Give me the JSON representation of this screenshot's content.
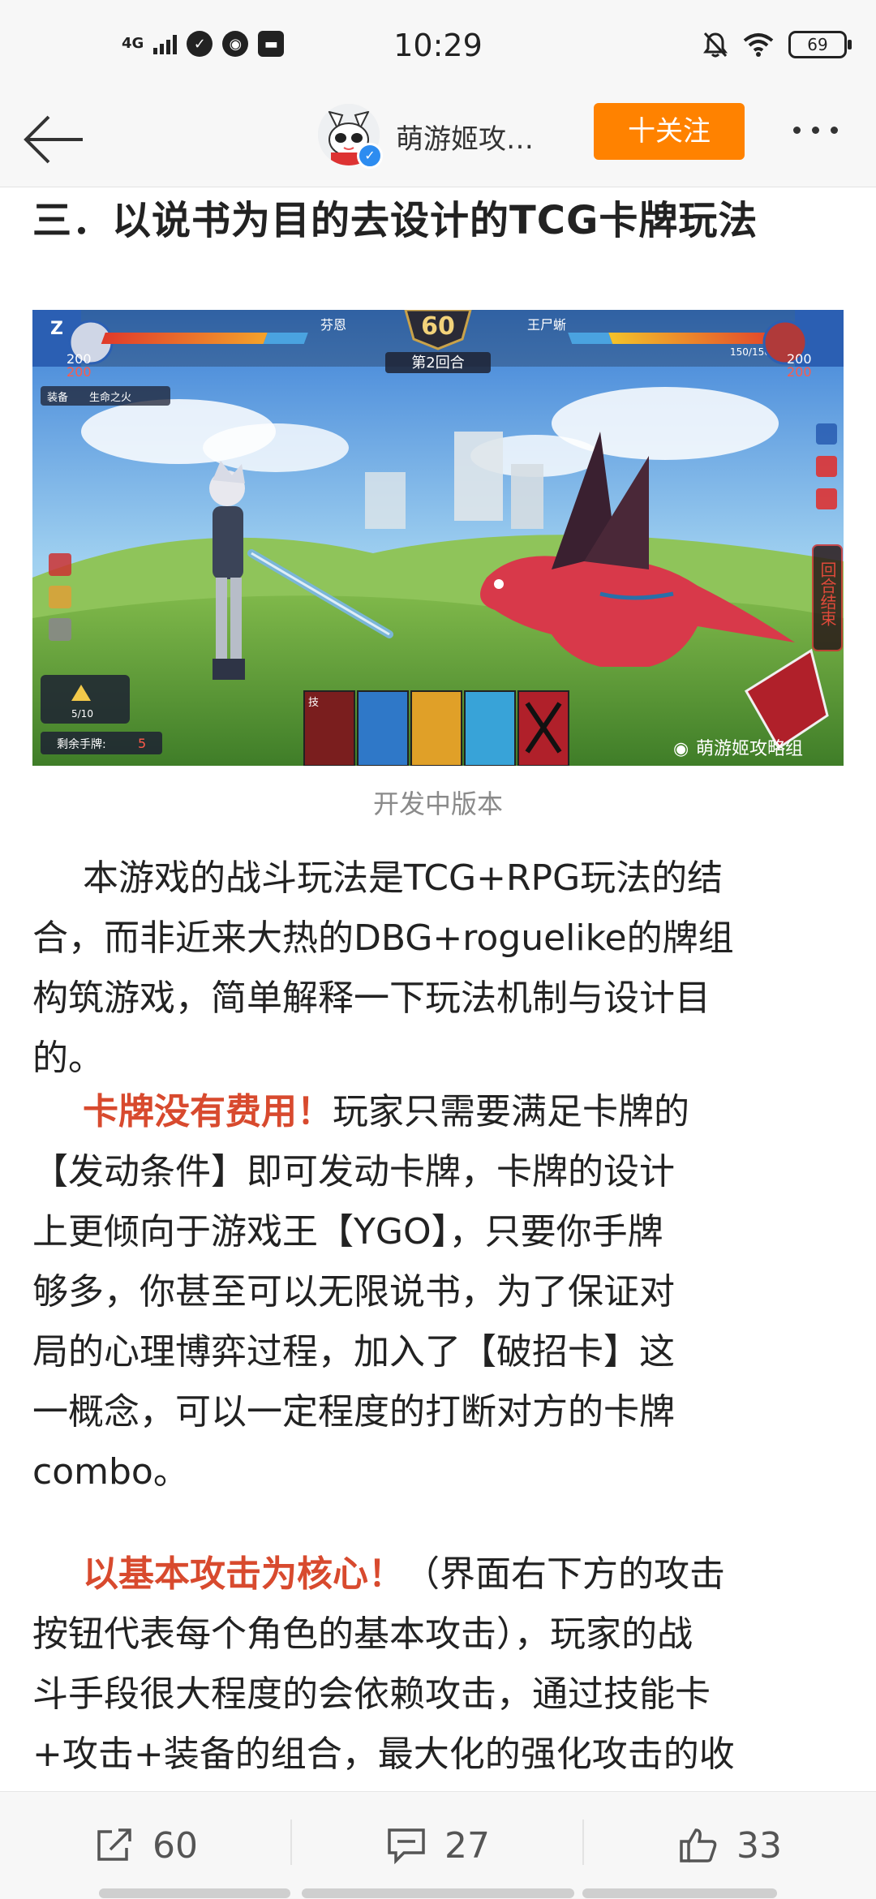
{
  "status_bar": {
    "network": "4G",
    "time": "10:29",
    "battery": "69"
  },
  "nav": {
    "title": "萌游姬攻…",
    "follow_label": "十关注"
  },
  "article": {
    "heading": "三．以说书为目的去设计的TCG卡牌玩法",
    "image": {
      "timer": "60",
      "round": "第2回合",
      "player_name": "芬恩",
      "enemy_name": "王尸蜥",
      "player_hp": "200",
      "player_shield": "200",
      "enemy_hp": "200",
      "enemy_shield": "200",
      "enemy_hp_text": "150/150",
      "equip_label": "装备",
      "equip_value": "生命之火",
      "hand_label": "剩余手牌:",
      "hand_count": "5",
      "deck_count": "5/10",
      "end_turn": "回合结束",
      "card_tag": "技",
      "watermark": "萌游姬攻略组"
    },
    "caption": "开发中版本",
    "para1_lines": [
      "本游戏的战斗玩法是TCG+RPG玩法的结",
      "合，而非近来大热的DBG+roguelike的牌组",
      "构筑游戏，简单解释一下玩法机制与设计目",
      "的。"
    ],
    "para2_highlight": "卡牌没有费用！",
    "para2_lines": [
      "玩家只需要满足卡牌的",
      "【发动条件】即可发动卡牌，卡牌的设计",
      "上更倾向于游戏王【YGO】，只要你手牌",
      "够多，你甚至可以无限说书，为了保证对",
      "局的心理博弈过程，加入了【破招卡】这",
      "一概念，可以一定程度的打断对方的卡牌",
      "combo。"
    ],
    "para3_highlight": "以基本攻击为核心！",
    "para3_lines": [
      "（界面右下方的攻击",
      "按钮代表每个角色的基本攻击），玩家的战",
      "斗手段很大程度的会依赖攻击，通过技能卡",
      "+攻击+装备的组合，最大化的强化攻击的收"
    ]
  },
  "toolbar": {
    "repost_count": "60",
    "comment_count": "27",
    "like_count": "33"
  },
  "colors": {
    "accent": "#ff8200",
    "highlight_text": "#d84a2e",
    "verified": "#2d8cf0"
  },
  "icons": [
    "back-arrow-icon",
    "share-icon",
    "comment-icon",
    "like-icon",
    "more-icon",
    "mute-icon",
    "wifi-icon",
    "battery-icon",
    "weibo-icon"
  ]
}
